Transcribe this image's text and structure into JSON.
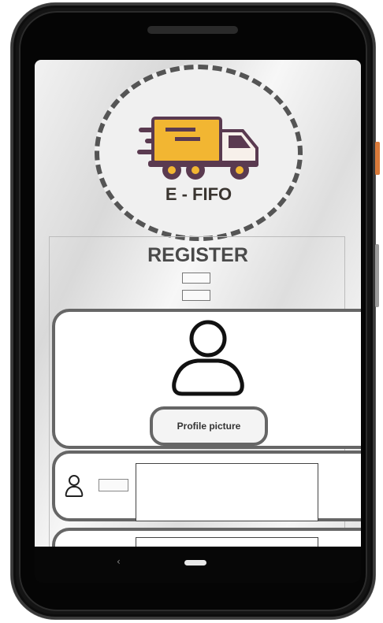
{
  "app": {
    "logo_text": "E - FIFO",
    "brand_color": "#f2b632",
    "truck_color": "#5a3a50"
  },
  "register": {
    "title": "REGISTER"
  },
  "profile": {
    "avatar_icon": "person-outline-icon",
    "button_label": "Profile picture"
  },
  "form": {
    "fields": [
      {
        "icon": "person-outline-icon",
        "label": "",
        "value": ""
      },
      {
        "icon": "",
        "label": "",
        "value": ""
      }
    ]
  },
  "navbar": {
    "back_glyph": "‹",
    "home_icon": "home-pill-icon"
  }
}
